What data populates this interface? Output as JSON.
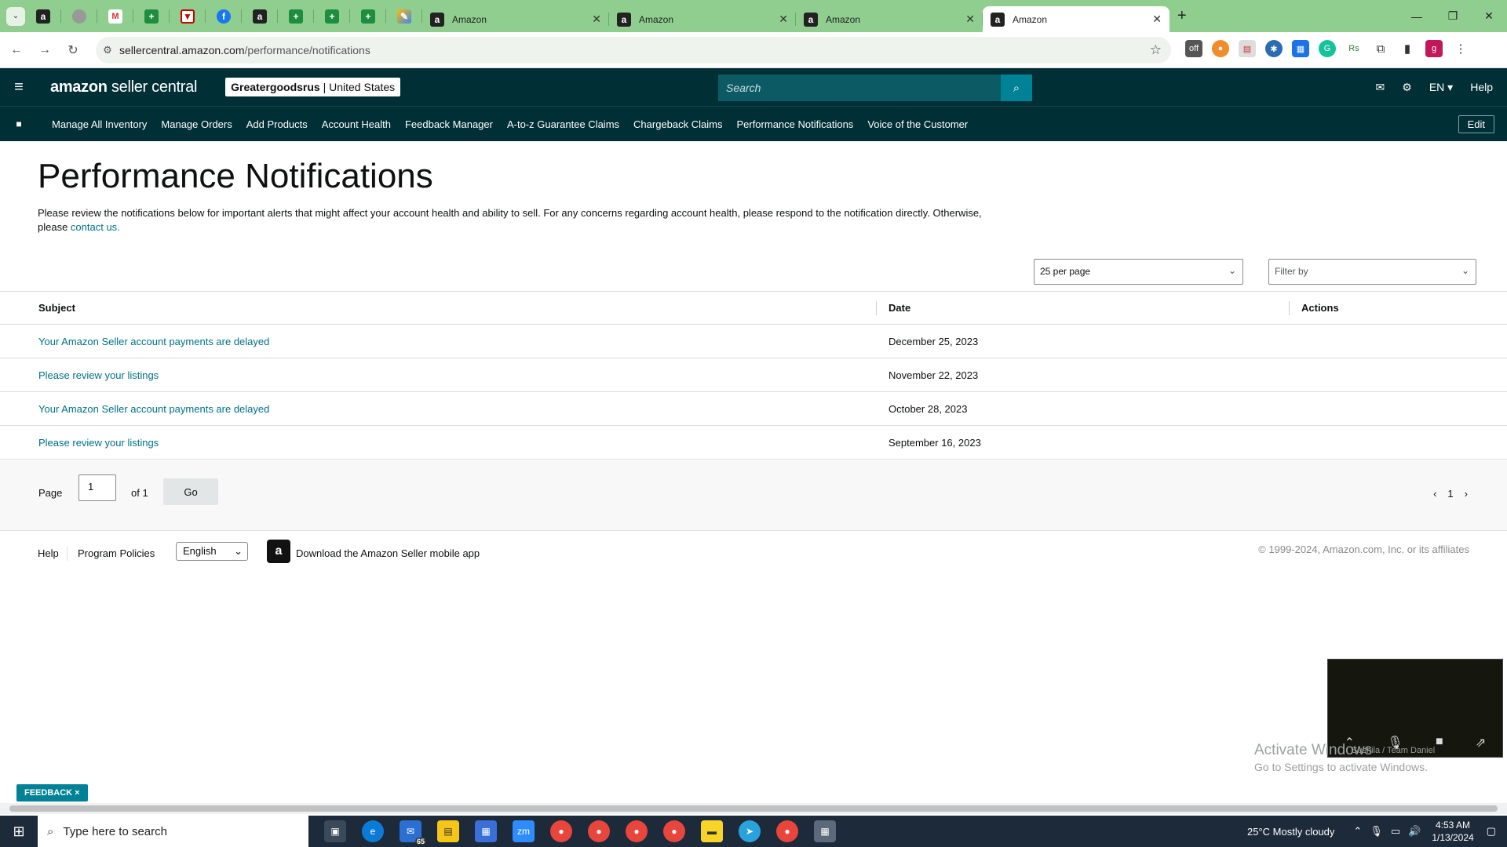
{
  "browser": {
    "tab_search_icon": "chevron-down-icon",
    "pinned_tabs": [
      {
        "icon": "amazon-icon",
        "glyph": "a",
        "cls": "amz"
      },
      {
        "icon": "globe-icon",
        "glyph": "",
        "cls": "gray"
      },
      {
        "icon": "gmail-icon",
        "glyph": "M",
        "cls": "gm"
      },
      {
        "icon": "sheets-icon",
        "glyph": "+",
        "cls": "green"
      },
      {
        "icon": "shield-icon",
        "glyph": "▼",
        "cls": "red"
      },
      {
        "icon": "facebook-icon",
        "glyph": "f",
        "cls": "fb"
      },
      {
        "icon": "amazon-icon",
        "glyph": "a",
        "cls": "amz"
      },
      {
        "icon": "sheets-icon",
        "glyph": "+",
        "cls": "green"
      },
      {
        "icon": "sheets-icon",
        "glyph": "+",
        "cls": "green"
      },
      {
        "icon": "sheets-icon",
        "glyph": "+",
        "cls": "green"
      },
      {
        "icon": "pen-icon",
        "glyph": "✎",
        "cls": "multi"
      }
    ],
    "tabs": [
      {
        "title": "Amazon",
        "active": false
      },
      {
        "title": "Amazon",
        "active": false
      },
      {
        "title": "Amazon",
        "active": false
      },
      {
        "title": "Amazon",
        "active": true
      }
    ],
    "url_host": "sellercentral.amazon.com",
    "url_path": "/performance/notifications",
    "profile_initial": "g"
  },
  "header": {
    "logo_bold": "amazon",
    "logo_rest": " seller central",
    "store_name": "Greatergoodsrus",
    "store_sep": " | ",
    "store_region": "United States",
    "search_placeholder": "Search",
    "lang": "EN ▾",
    "help": "Help"
  },
  "nav": {
    "items": [
      "Manage All Inventory",
      "Manage Orders",
      "Add Products",
      "Account Health",
      "Feedback Manager",
      "A-to-z Guarantee Claims",
      "Chargeback Claims",
      "Performance Notifications",
      "Voice of the Customer"
    ],
    "edit": "Edit"
  },
  "page": {
    "title": "Performance Notifications",
    "desc_text": "Please review the notifications below for important alerts that might affect your account health and ability to sell. For any concerns regarding account health, please respond to the notification directly. Otherwise, please ",
    "desc_link": "contact us.",
    "per_page": "25 per page",
    "filter_placeholder": "Filter by"
  },
  "table": {
    "headers": {
      "subject": "Subject",
      "date": "Date",
      "actions": "Actions"
    },
    "rows": [
      {
        "subject": "Your Amazon Seller account payments are delayed",
        "date": "December 25, 2023"
      },
      {
        "subject": "Please review your listings",
        "date": "November 22, 2023"
      },
      {
        "subject": "Your Amazon Seller account payments are delayed",
        "date": "October 28, 2023"
      },
      {
        "subject": "Please review your listings",
        "date": "September 16, 2023"
      }
    ]
  },
  "pager": {
    "page_label": "Page",
    "page_value": "1",
    "of_label": "of 1",
    "go": "Go",
    "current": "1"
  },
  "footer": {
    "help": "Help",
    "policies": "Program Policies",
    "language": "English",
    "app_text": "Download the Amazon Seller mobile app",
    "copyright": "© 1999-2024, Amazon.com, Inc. or its affiliates"
  },
  "overlay": {
    "video_name": "Sushila / Team Daniel",
    "activate_title": "Activate Windows",
    "activate_sub": "Go to Settings to activate Windows.",
    "feedback": "FEEDBACK ×"
  },
  "taskbar": {
    "search_placeholder": "Type here to search",
    "mail_badge": "65",
    "weather": "25°C  Mostly cloudy",
    "time": "4:53 AM",
    "date": "1/13/2024"
  },
  "colors": {
    "header_bg": "#002f36",
    "accent": "#008296",
    "link": "#007185",
    "tabstrip": "#8fce8e"
  }
}
